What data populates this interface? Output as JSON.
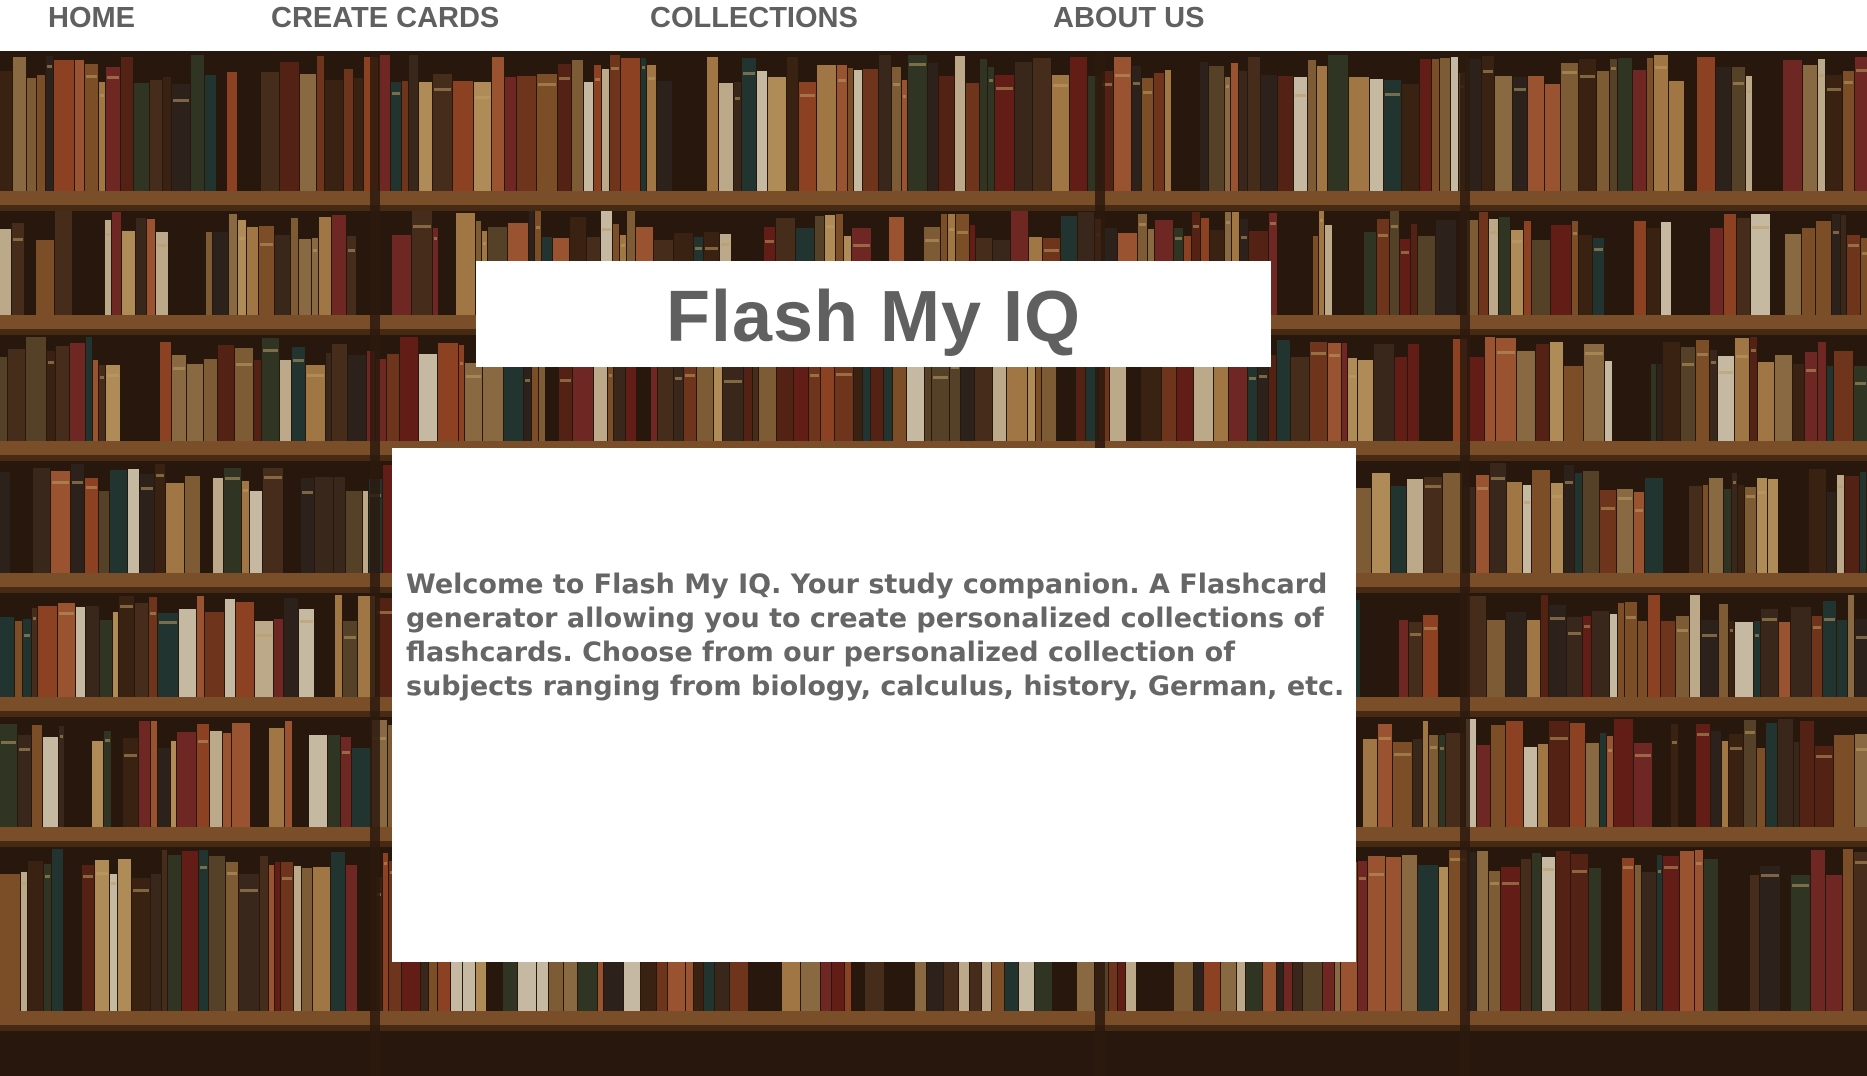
{
  "nav": {
    "items": [
      {
        "label": "HOME"
      },
      {
        "label": "CREATE CARDS"
      },
      {
        "label": "COLLECTIONS"
      },
      {
        "label": "ABOUT US"
      }
    ]
  },
  "hero": {
    "title": "Flash My IQ"
  },
  "welcome": {
    "text": "Welcome to Flash My IQ. Your study companion. A Flashcard generator allowing you to create personalized collections of flashcards. Choose from our personalized collection of subjects ranging from biology, calculus, history, German, etc."
  },
  "colors": {
    "nav_text": "#606060",
    "title_text": "#606060",
    "body_text": "#666666",
    "panel_background": "#ffffff"
  },
  "icons": {
    "background": "bookshelf-image"
  }
}
